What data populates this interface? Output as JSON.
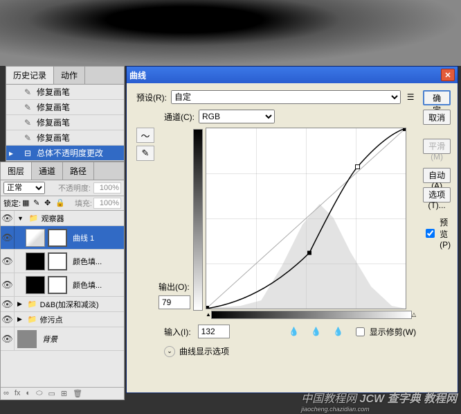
{
  "history_panel": {
    "tabs": [
      "历史记录",
      "动作"
    ],
    "items": [
      {
        "icon": "brush",
        "label": "修复画笔"
      },
      {
        "icon": "brush",
        "label": "修复画笔"
      },
      {
        "icon": "brush",
        "label": "修复画笔"
      },
      {
        "icon": "brush",
        "label": "修复画笔"
      },
      {
        "icon": "slider",
        "label": "总体不透明度更改"
      }
    ]
  },
  "layers_panel": {
    "tabs": [
      "图层",
      "通道",
      "路径"
    ],
    "blend_mode": "正常",
    "opacity_label": "不透明度:",
    "opacity_value": "100%",
    "lock_label": "锁定:",
    "fill_label": "填充:",
    "fill_value": "100%",
    "layers": [
      {
        "type": "group",
        "name": "观察器",
        "expanded": true
      },
      {
        "type": "adjust",
        "name": "曲线 1",
        "thumb": "curves",
        "selected": true,
        "indent": 1
      },
      {
        "type": "adjust",
        "name": "颜色填...",
        "thumb": "black",
        "indent": 1
      },
      {
        "type": "adjust",
        "name": "颜色填...",
        "thumb": "black",
        "indent": 1
      },
      {
        "type": "group",
        "name": "D&B(加深和减淡)",
        "expanded": false
      },
      {
        "type": "group",
        "name": "修污点",
        "expanded": false
      },
      {
        "type": "layer",
        "name": "背景",
        "thumb": "bg",
        "italic": true
      }
    ],
    "footer_icons": [
      "∞",
      "fx",
      "◐",
      "⬭",
      "▭",
      "⊞",
      "🗑"
    ]
  },
  "dialog": {
    "title": "曲线",
    "preset_label": "预设(R):",
    "preset_value": "自定",
    "channel_label": "通道(C):",
    "channel_value": "RGB",
    "output_label": "输出(O):",
    "output_value": "79",
    "input_label": "输入(I):",
    "input_value": "132",
    "show_clipping_label": "显示修剪(W)",
    "expand_label": "曲线显示选项",
    "buttons": {
      "ok": "确定",
      "cancel": "取消",
      "smooth": "平滑(M)",
      "auto": "自动(A)",
      "options": "选项(T)...",
      "preview": "预览(P)"
    }
  },
  "chart_data": {
    "type": "line",
    "title": "曲线",
    "xlabel": "输入",
    "ylabel": "输出",
    "xlim": [
      0,
      255
    ],
    "ylim": [
      0,
      255
    ],
    "series": [
      {
        "name": "baseline",
        "x": [
          0,
          255
        ],
        "y": [
          0,
          255
        ]
      },
      {
        "name": "curve",
        "x": [
          0,
          50,
          100,
          132,
          160,
          193,
          230,
          255
        ],
        "y": [
          0,
          8,
          30,
          79,
          140,
          200,
          240,
          255
        ]
      }
    ],
    "control_points": [
      {
        "x": 132,
        "y": 79,
        "selected": true
      },
      {
        "x": 193,
        "y": 200,
        "selected": false
      }
    ]
  },
  "watermark": {
    "line1": "中国教程网",
    "line2": "jiaocheng.chazidian.com",
    "line3": "JCW 查字典 教程网"
  }
}
